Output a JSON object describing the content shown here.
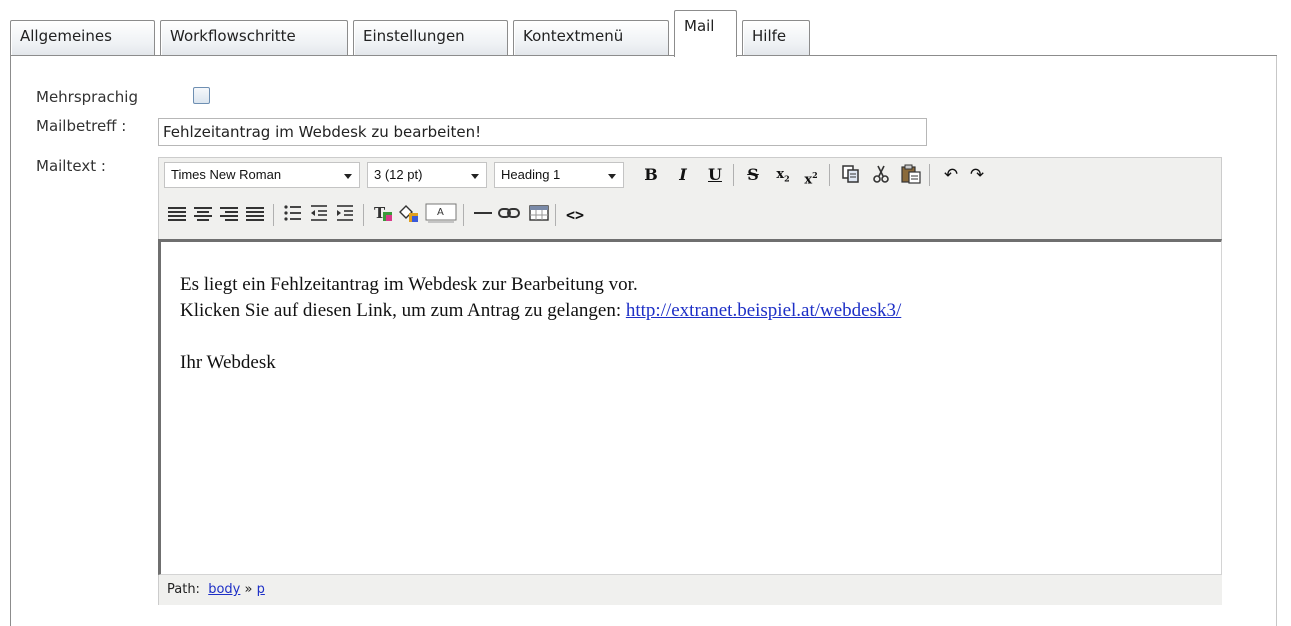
{
  "tabs": [
    {
      "label": "Allgemeines",
      "active": false
    },
    {
      "label": "Workflowschritte",
      "active": false
    },
    {
      "label": "Einstellungen",
      "active": false
    },
    {
      "label": "Kontextmenü",
      "active": false
    },
    {
      "label": "Mail",
      "active": true
    },
    {
      "label": "Hilfe",
      "active": false
    }
  ],
  "form": {
    "multilingual_label": "Mehrsprachig",
    "multilingual_checked": false,
    "subject_label": "Mailbetreff :",
    "subject_value": "Fehlzeitantrag im Webdesk zu bearbeiten!",
    "body_label": "Mailtext :"
  },
  "editor": {
    "font_family": "Times New Roman",
    "font_size": "3 (12 pt)",
    "block_format": "Heading 1",
    "toolbar_icons": [
      "bold-icon",
      "italic-icon",
      "underline-icon",
      "strikethrough-icon",
      "subscript-icon",
      "superscript-icon",
      "copy-icon",
      "cut-icon",
      "paste-icon",
      "undo-icon",
      "redo-icon",
      "align-left-icon",
      "align-center-icon",
      "align-right-icon",
      "align-justify-icon",
      "bullet-list-icon",
      "outdent-icon",
      "indent-icon",
      "text-color-icon",
      "background-color-icon",
      "text-style-icon",
      "horizontal-rule-icon",
      "link-icon",
      "table-icon",
      "source-code-icon"
    ],
    "content": {
      "line1": "Es liegt ein Fehlzeitantrag im Webdesk zur Bearbeitung vor.",
      "line2_prefix": "Klicken Sie auf diesen Link, um zum Antrag zu gelangen: ",
      "link": "http://extranet.beispiel.at/webdesk3/",
      "signature": "Ihr Webdesk"
    },
    "path_label": "Path:",
    "path": [
      "body",
      "p"
    ],
    "path_separator": "»"
  },
  "colors": {
    "link": "#1d2fc6",
    "toolbar_bg": "#f0f0ee",
    "tab_border": "#8c8c8c"
  }
}
